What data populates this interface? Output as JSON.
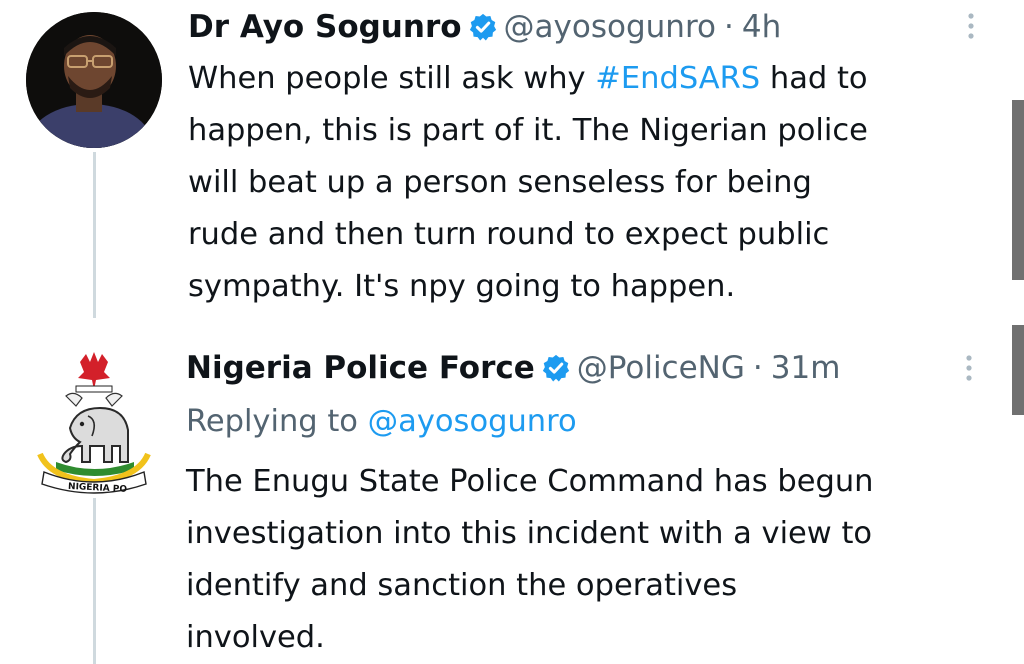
{
  "tweets": [
    {
      "display_name": "Dr Ayo Sogunro",
      "handle": "@ayosogunro",
      "separator": "·",
      "time": "4h",
      "text": {
        "line1_before": "When people still ask why ",
        "hashtag": "#EndSARS",
        "line1_after": " had to",
        "line2": "happen, this is part of it. The Nigerian police",
        "line3": "will beat up a person senseless for being",
        "line4": "rude and then turn round to expect public",
        "line5": "sympathy. It's npy going to happen."
      },
      "avatar_icon": "profile-photo",
      "verified": true
    },
    {
      "display_name": "Nigeria Police Force",
      "handle": "@PoliceNG",
      "separator": "·",
      "time": "31m",
      "replying_to_label": "Replying to ",
      "replying_to_handle": "@ayosogunro",
      "text": {
        "line1": "The Enugu State Police Command has begun",
        "line2": "investigation into this incident with a view to",
        "line3": "identify and sanction the operatives",
        "line4": "involved."
      },
      "avatar_icon": "nigeria-coat-of-arms-logo",
      "logo_text": "NIGERIA PO",
      "verified": true
    }
  ],
  "colors": {
    "text": "#0f1419",
    "secondary": "#536471",
    "link": "#1d9bf0",
    "verified": "#1d9bf0",
    "thread_line": "#cfd9de"
  }
}
